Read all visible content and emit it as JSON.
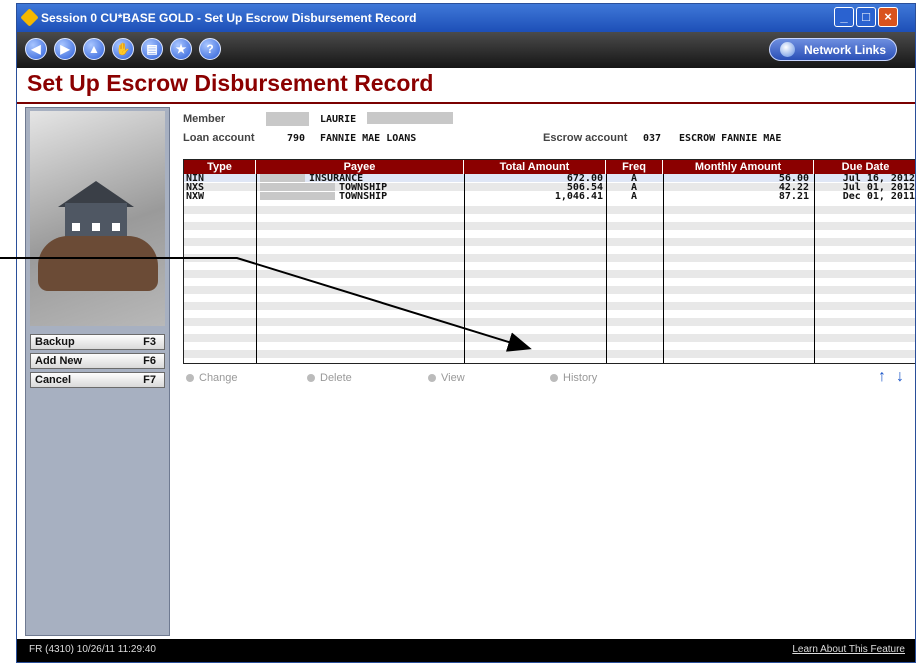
{
  "window": {
    "title": "Session 0 CU*BASE GOLD - Set Up Escrow Disbursement Record",
    "controls": [
      "minimize",
      "restore",
      "close"
    ]
  },
  "toolbar": {
    "nav_icons": [
      "back-icon",
      "forward-icon",
      "up-icon",
      "hand-icon",
      "print-icon",
      "star-icon",
      "help-icon"
    ],
    "network_links_label": "Network Links"
  },
  "page": {
    "title": "Set Up Escrow Disbursement Record"
  },
  "member_info": {
    "member_label": "Member",
    "member_name": "LAURIE",
    "loan_label": "Loan account",
    "loan_number": "790",
    "loan_name": "FANNIE MAE LOANS",
    "escrow_label": "Escrow account",
    "escrow_number": "037",
    "escrow_name": "ESCROW FANNIE MAE"
  },
  "sidebar": {
    "buttons": [
      {
        "label": "Backup",
        "key": "F3"
      },
      {
        "label": "Add New",
        "key": "F6"
      },
      {
        "label": "Cancel",
        "key": "F7"
      }
    ]
  },
  "table": {
    "columns": [
      "Type",
      "Payee",
      "Total Amount",
      "Freq",
      "Monthly Amount",
      "Due Date"
    ],
    "rows": [
      {
        "type": "NIN",
        "payee": "INSURANCE",
        "total": "672.00",
        "freq": "A",
        "monthly": "56.00",
        "due": "Jul 16, 2012"
      },
      {
        "type": "NXS",
        "payee": "TOWNSHIP",
        "total": "506.54",
        "freq": "A",
        "monthly": "42.22",
        "due": "Jul 01, 2012"
      },
      {
        "type": "NXW",
        "payee": "TOWNSHIP",
        "total": "1,046.41",
        "freq": "A",
        "monthly": "87.21",
        "due": "Dec 01, 2011"
      }
    ]
  },
  "actions": [
    "Change",
    "Delete",
    "View",
    "History"
  ],
  "status": {
    "left": "FR (4310) 10/26/11 11:29:40",
    "right": "Learn About This Feature"
  },
  "colors": {
    "title_red": "#8b0000",
    "titlebar_blue": "#1d4fb7",
    "arrow_blue": "#1c56c9"
  }
}
